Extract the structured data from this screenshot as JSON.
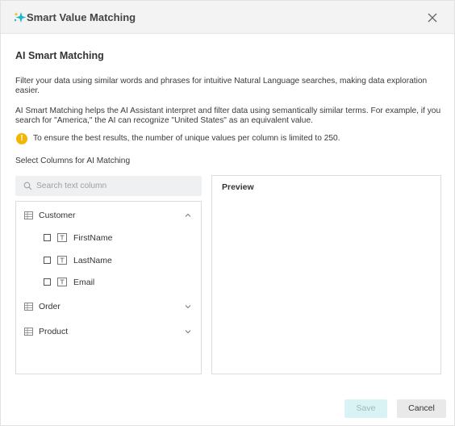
{
  "dialog": {
    "title": "Smart Value Matching",
    "icons": {
      "title": "sparkle-icon",
      "close": "close-icon"
    },
    "colors": {
      "sparkle": "#1db8c8",
      "warning": "#f2b705",
      "save_bg": "#d9f3f5",
      "cancel_bg": "#e9e9e9"
    }
  },
  "content": {
    "section_title": "AI Smart Matching",
    "paragraph1": "Filter your data using similar words and phrases for intuitive Natural Language searches, making data exploration easier.",
    "paragraph2": "AI Smart Matching helps the AI Assistant interpret and filter data using semantically similar terms. For example, if you search for \"America,\" the AI can recognize \"United States\" as an equivalent value.",
    "warning_icon": "!",
    "warning": "To ensure the best results, the number of unique values per column is limited to 250.",
    "select_label": "Select Columns for AI Matching"
  },
  "search": {
    "placeholder": "Search text column",
    "value": ""
  },
  "tree": [
    {
      "label": "Customer",
      "expanded": true,
      "fields": [
        "FirstName",
        "LastName",
        "Email"
      ]
    },
    {
      "label": "Order",
      "expanded": false,
      "fields": []
    },
    {
      "label": "Product",
      "expanded": false,
      "fields": []
    }
  ],
  "preview": {
    "title": "Preview"
  },
  "footer": {
    "save_label": "Save",
    "cancel_label": "Cancel"
  }
}
